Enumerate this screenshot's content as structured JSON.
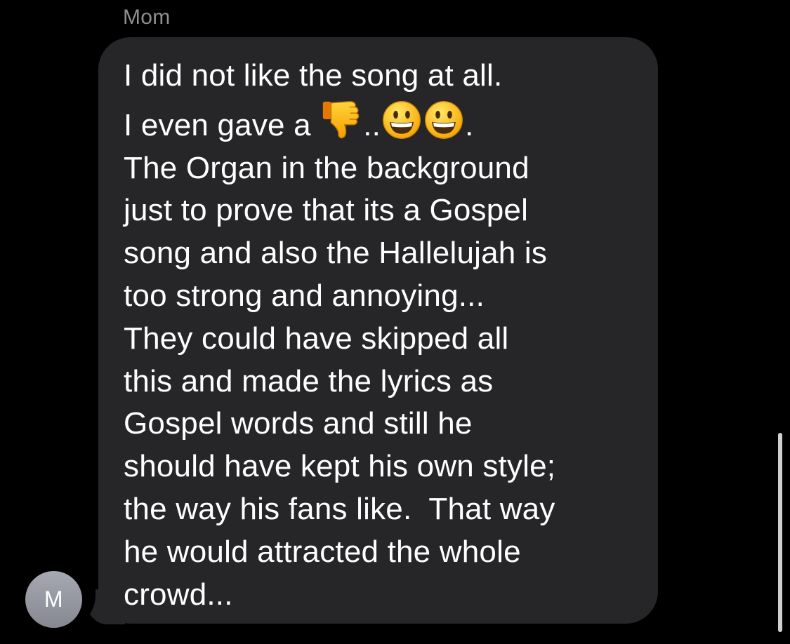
{
  "conversation": {
    "sender_name": "Mom",
    "avatar_initial": "M"
  },
  "message": {
    "line_1": "I did not like the song at all.",
    "line_2": {
      "before": "I even gave a ",
      "emoji_1": "thumbs-down-icon",
      "between": "..",
      "emoji_2": "grinning-face-icon",
      "emoji_3": "grinning-face-icon",
      "after": "."
    },
    "line_3": "The Organ in the background",
    "line_4": "just to prove that its a Gospel",
    "line_5": "song and also the Hallelujah is",
    "line_6": "too strong and annoying...",
    "line_7": "They could have skipped all",
    "line_8": "this and made the lyrics as",
    "line_9": "Gospel words and still he",
    "line_10": "should have kept his own style;",
    "line_11": "the way his fans like.  That way",
    "line_12": "he would attracted the whole",
    "line_13": "crowd..."
  },
  "colors": {
    "background": "#000000",
    "bubble": "#262629",
    "text": "#ffffff",
    "sender_name": "#8e8e93",
    "avatar": "#9a9ca5"
  }
}
